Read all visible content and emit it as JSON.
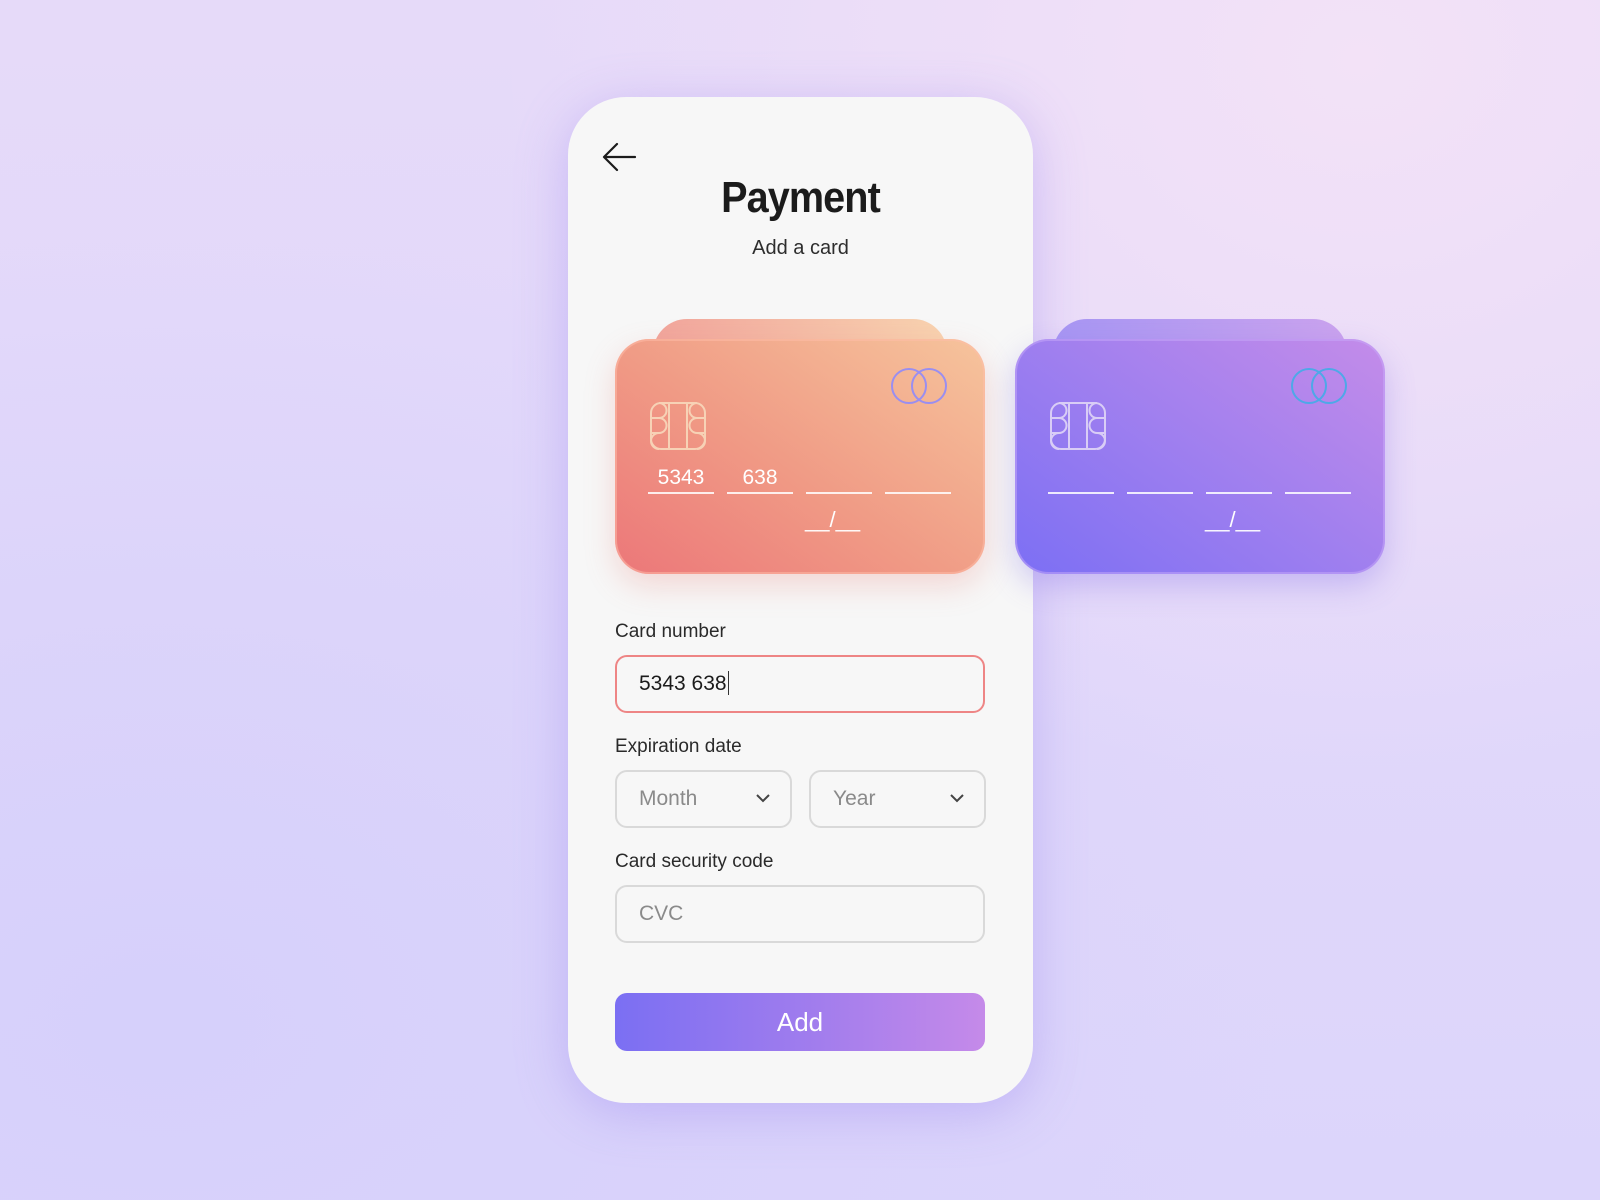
{
  "header": {
    "back_icon": "arrow-left-icon",
    "title": "Payment",
    "subtitle": "Add a card"
  },
  "cards": [
    {
      "theme": "orange",
      "number_groups": [
        "5343",
        "638",
        "",
        ""
      ],
      "expiry": "__/__",
      "chip_icon": "chip-icon",
      "brand_icon": "interlocking-rings-icon",
      "colors": {
        "start": "#ec7779",
        "end": "#f6c49c"
      }
    },
    {
      "theme": "purple",
      "number_groups": [
        "",
        "",
        "",
        ""
      ],
      "expiry": "__/__",
      "chip_icon": "chip-icon",
      "brand_icon": "interlocking-rings-icon",
      "colors": {
        "start": "#7c6ff4",
        "end": "#c48ce9"
      }
    }
  ],
  "form": {
    "card_number": {
      "label": "Card number",
      "value": "5343 638"
    },
    "expiration": {
      "label": "Expiration date",
      "month": {
        "placeholder": "Month"
      },
      "year": {
        "placeholder": "Year"
      }
    },
    "security_code": {
      "label": "Card security code",
      "placeholder": "CVC"
    },
    "submit_label": "Add"
  },
  "colors": {
    "accent_start": "#7b6ff3",
    "accent_end": "#c58ae9",
    "active_border": "#ee8585",
    "panel_bg": "#f7f7f7"
  }
}
